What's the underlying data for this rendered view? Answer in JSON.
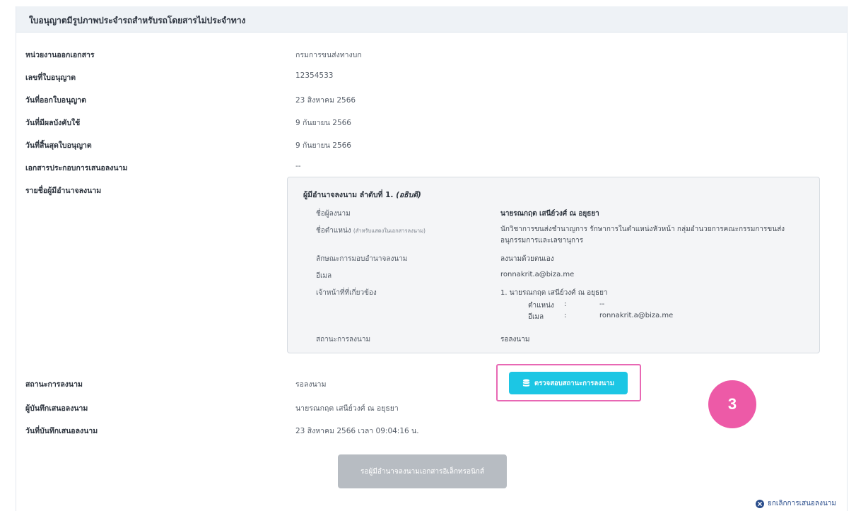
{
  "card": {
    "title": "ใบอนุญาตมีรูปภาพประจำรถสำหรับรถโดยสารไม่ประจำทาง"
  },
  "details": [
    {
      "label": "หน่วยงานออกเอกสาร",
      "value": "กรมการขนส่งทางบก"
    },
    {
      "label": "เลขที่ใบอนุญาต",
      "value": "12354533"
    },
    {
      "label": "วันที่ออกใบอนุญาต",
      "value": "23 สิงหาคม 2566"
    },
    {
      "label": "วันที่มีผลบังคับใช้",
      "value": "9 กันยายน 2566"
    },
    {
      "label": "วันที่สิ้นสุดใบอนุญาต",
      "value": "9 กันยายน 2566"
    },
    {
      "label": "เอกสารประกอบการเสนอลงนาม",
      "value": "--"
    },
    {
      "label": "รายชื่อผู้มีอำนาจลงนาม",
      "value": ""
    }
  ],
  "signer": {
    "heading": "ผู้มีอำนาจลงนาม ลำดับที่ 1.",
    "heading_role": "(อธิบดี)",
    "name_label": "ชื่อผู้ลงนาม",
    "name_value": "นายรณกฤต เสนีย์วงศ์ ณ อยุธยา",
    "position_label": "ชื่อตำแหน่ง",
    "position_note": "(สำหรับแสดงในเอกสารลงนาม)",
    "position_value": "นักวิชาการขนส่งชำนาญการ รักษาการในตำแหน่งหัวหน้า กลุ่มอำนวยการคณะกรรมการขนส่งอนุกรรมการและเลขานุการ",
    "delegation_label": "ลักษณะการมอบอำนาจลงนาม",
    "delegation_value": "ลงนามด้วยตนเอง",
    "email_label": "อีเมล",
    "email_value": "ronnakrit.a@biza.me",
    "officer_label": "เจ้าหน้าที่ที่เกี่ยวข้อง",
    "officer_value": "1. นายรณกฤต เสนีย์วงศ์ ณ อยุธยา",
    "officer_position_key": "ตำแหน่ง",
    "officer_position_colon": ":",
    "officer_position_value": "--",
    "officer_email_key": "อีเมล",
    "officer_email_colon": ":",
    "officer_email_value": "ronnakrit.a@biza.me",
    "status_label": "สถานะการลงนาม",
    "status_value": "รอลงนาม"
  },
  "footer_details": [
    {
      "label": "สถานะการลงนาม",
      "value": "รอลงนาม"
    },
    {
      "label": "ผู้บันทึกเสนอลงนาม",
      "value": "นายรณกฤต เสนีย์วงศ์ ณ อยุธยา"
    },
    {
      "label": "วันที่บันทึกเสนอลงนาม",
      "value": "23 สิงหาคม 2566 เวลา 09:04:16 น."
    }
  ],
  "buttons": {
    "check_status": "ตรวจสอบสถานะการลงนาม",
    "check_status_icon": "database-icon",
    "waiting": "รอผู้มีอำนาจลงนามเอกสารอิเล็กทรอนิกส์",
    "cancel": "ยกเลิกการเสนอลงนาม",
    "cancel_icon": "close-circle-icon"
  },
  "annotation": {
    "step": "3"
  },
  "colors": {
    "primary": "#1cc6e4",
    "highlight": "#e868b4",
    "badge": "#ed5aa7",
    "disabled": "#b7bcc2",
    "link": "#2b4e8c"
  }
}
